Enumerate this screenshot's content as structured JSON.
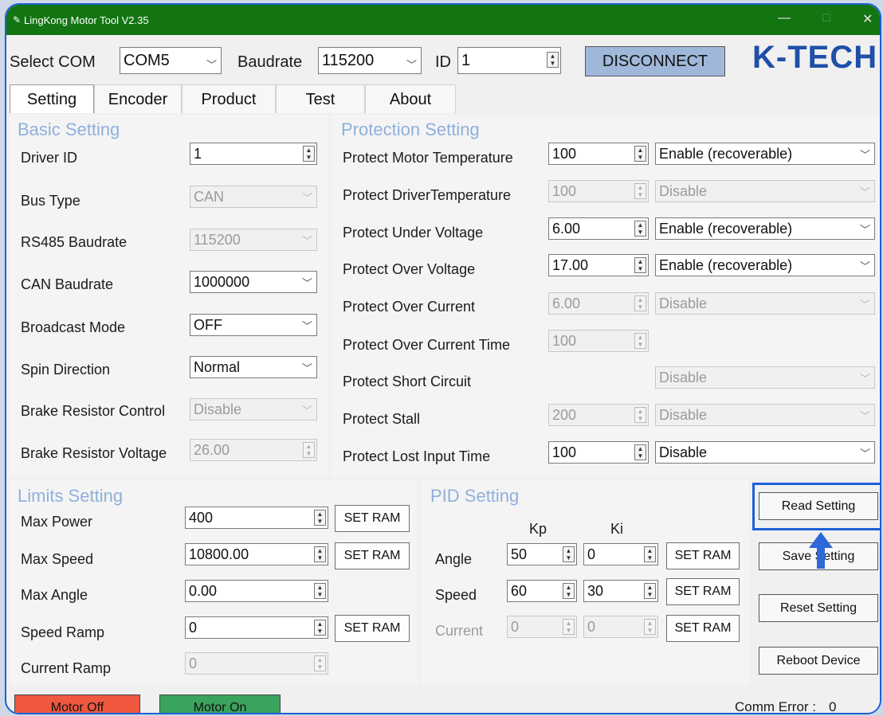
{
  "window": {
    "title": "LingKong Motor Tool V2.35",
    "minimize": "—",
    "maximize": "□",
    "close": "✕"
  },
  "toolbar": {
    "com_label": "Select COM",
    "com_value": "COM5",
    "baud_label": "Baudrate",
    "baud_value": "115200",
    "id_label": "ID",
    "id_value": "1",
    "disconnect": "DISCONNECT",
    "logo": "K-TECH"
  },
  "tabs": [
    "Setting",
    "Encoder",
    "Product",
    "Test",
    "About"
  ],
  "basic": {
    "title": "Basic Setting",
    "driver_id": {
      "label": "Driver ID",
      "value": "1"
    },
    "bus_type": {
      "label": "Bus Type",
      "value": "CAN"
    },
    "rs485": {
      "label": "RS485 Baudrate",
      "value": "115200"
    },
    "can_baud": {
      "label": "CAN Baudrate",
      "value": "1000000"
    },
    "broadcast": {
      "label": "Broadcast Mode",
      "value": "OFF"
    },
    "spin": {
      "label": "Spin Direction",
      "value": "Normal"
    },
    "brake_ctrl": {
      "label": "Brake Resistor Control",
      "value": "Disable"
    },
    "brake_volt": {
      "label": "Brake Resistor Voltage",
      "value": "26.00"
    }
  },
  "protection": {
    "title": "Protection Setting",
    "rows": [
      {
        "label": "Protect Motor Temperature",
        "value": "100",
        "mode": "Enable (recoverable)"
      },
      {
        "label": "Protect DriverTemperature",
        "value": "100",
        "mode": "Disable"
      },
      {
        "label": "Protect Under Voltage",
        "value": "6.00",
        "mode": "Enable (recoverable)"
      },
      {
        "label": "Protect Over Voltage",
        "value": "17.00",
        "mode": "Enable (recoverable)"
      },
      {
        "label": "Protect Over Current",
        "value": "6.00",
        "mode": "Disable"
      },
      {
        "label": "Protect Over Current Time",
        "value": "100"
      },
      {
        "label": "Protect Short Circuit",
        "mode": "Disable"
      },
      {
        "label": "Protect Stall",
        "value": "200",
        "mode": "Disable"
      },
      {
        "label": "Protect Lost Input Time",
        "value": "100",
        "mode": "Disable"
      }
    ]
  },
  "limits": {
    "title": "Limits Setting",
    "rows": [
      {
        "label": "Max Power",
        "value": "400"
      },
      {
        "label": "Max Speed",
        "value": "10800.00"
      },
      {
        "label": "Max Angle",
        "value": "0.00"
      },
      {
        "label": "Speed Ramp",
        "value": "0"
      },
      {
        "label": "Current Ramp",
        "value": "0"
      }
    ],
    "set_ram": "SET RAM"
  },
  "pid": {
    "title": "PID Setting",
    "kp_header": "Kp",
    "ki_header": "Ki",
    "rows": [
      {
        "label": "Angle",
        "kp": "50",
        "ki": "0"
      },
      {
        "label": "Speed",
        "kp": "60",
        "ki": "30"
      },
      {
        "label": "Current",
        "kp": "0",
        "ki": "0"
      }
    ],
    "set_ram": "SET RAM"
  },
  "actions": {
    "read": "Read Setting",
    "save": "Save Setting",
    "reset": "Reset Setting",
    "reboot": "Reboot Device"
  },
  "status": {
    "motor_off": "Motor Off",
    "motor_on": "Motor On",
    "comm_error_label": "Comm Error :",
    "comm_error_value": "0"
  },
  "colors": {
    "titlebar": "#127512",
    "motor_off": "#f0573f",
    "motor_on": "#3aa35d",
    "highlight": "#1d5fd6",
    "disconnect_bg": "#9fb8d9"
  }
}
